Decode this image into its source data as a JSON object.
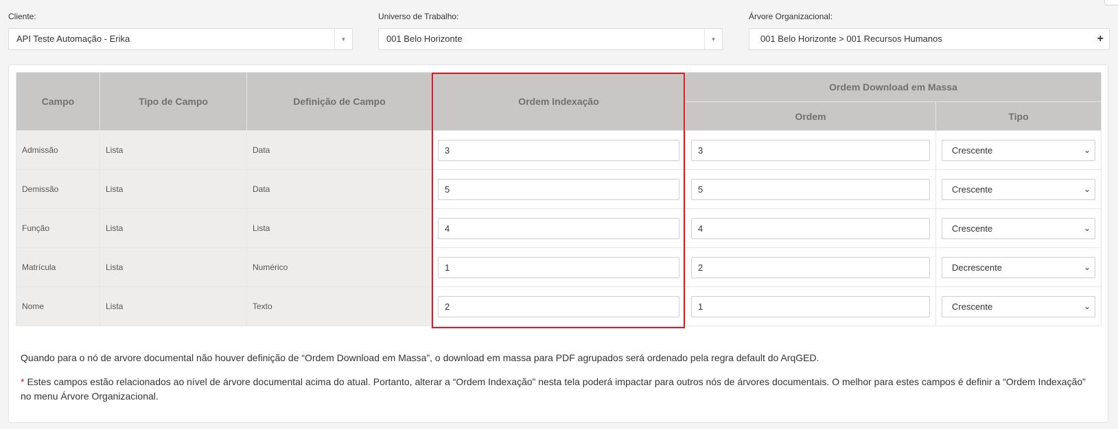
{
  "filters": {
    "cliente": {
      "label": "Cliente:",
      "value": "API Teste Automação - Erika"
    },
    "universo": {
      "label": "Universo de Trabalho:",
      "value": "001 Belo Horizonte"
    },
    "arvore": {
      "label": "Árvore Organizacional:",
      "value": "001 Belo Horizonte > 001 Recursos Humanos",
      "add_symbol": "+"
    }
  },
  "table": {
    "headers": {
      "campo": "Campo",
      "tipo_campo": "Tipo de Campo",
      "definicao": "Definição de Campo",
      "ordem_indexacao": "Ordem Indexação",
      "download_group": "Ordem Download em Massa",
      "ordem": "Ordem",
      "tipo": "Tipo"
    },
    "rows": [
      {
        "campo": "Admissão",
        "tipo_campo": "Lista",
        "definicao": "Data",
        "ordem_indexacao": "3",
        "ordem": "3",
        "tipo": "Crescente"
      },
      {
        "campo": "Demissão",
        "tipo_campo": "Lista",
        "definicao": "Data",
        "ordem_indexacao": "5",
        "ordem": "5",
        "tipo": "Crescente"
      },
      {
        "campo": "Função",
        "tipo_campo": "Lista",
        "definicao": "Lista",
        "ordem_indexacao": "4",
        "ordem": "4",
        "tipo": "Crescente"
      },
      {
        "campo": "Matrícula",
        "tipo_campo": "Lista",
        "definicao": "Numérico",
        "ordem_indexacao": "1",
        "ordem": "2",
        "tipo": "Decrescente"
      },
      {
        "campo": "Nome",
        "tipo_campo": "Lista",
        "definicao": "Texto",
        "ordem_indexacao": "2",
        "ordem": "1",
        "tipo": "Crescente"
      }
    ]
  },
  "notes": {
    "note1": "Quando para o nó de arvore documental não houver definição de “Ordem Download em Massa”, o download em massa para PDF agrupados será ordenado pela regra default do ArqGED.",
    "star": "*",
    "note2": "Estes campos estão relacionados ao nível de árvore documental acima do atual. Portanto, alterar a “Ordem Indexação” nesta tela poderá impactar para outros nós de árvores documentais. O melhor para estes campos é definir a “Ordem Indexação” no menu Árvore Organizacional."
  },
  "icons": {
    "dropdown_arrow": "▼",
    "select_chevron": "⌄"
  },
  "colors": {
    "highlight": "#e8141f",
    "header_bg": "#c9c6c6",
    "readonly_bg": "#eeedec"
  }
}
